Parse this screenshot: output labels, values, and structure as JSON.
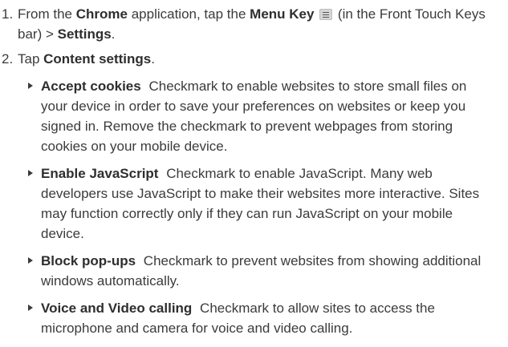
{
  "steps": [
    {
      "number": "1.",
      "before": "From the ",
      "app": "Chrome",
      "middle": " application, tap the ",
      "key_label": "Menu Key",
      "icon": "menu-icon",
      "after": " (in the Front Touch Keys bar) > ",
      "settings": "Settings",
      "end": "."
    },
    {
      "number": "2.",
      "before": "Tap ",
      "target": "Content settings",
      "end": "."
    }
  ],
  "bullets": [
    {
      "title": "Accept cookies",
      "text": "Checkmark to enable websites to store small files on your device in order to save your preferences on websites or keep you signed in. Remove the checkmark to prevent webpages from storing cookies on your mobile device."
    },
    {
      "title": "Enable JavaScript",
      "text": "Checkmark to enable JavaScript. Many web developers use JavaScript to make their websites more interactive. Sites may function correctly only if they can run JavaScript on your mobile device."
    },
    {
      "title": "Block pop-ups",
      "text": "Checkmark to prevent websites from showing additional windows automatically."
    },
    {
      "title": "Voice and Video calling",
      "text": "Checkmark to allow sites to access the microphone and camera for voice and video calling."
    }
  ]
}
